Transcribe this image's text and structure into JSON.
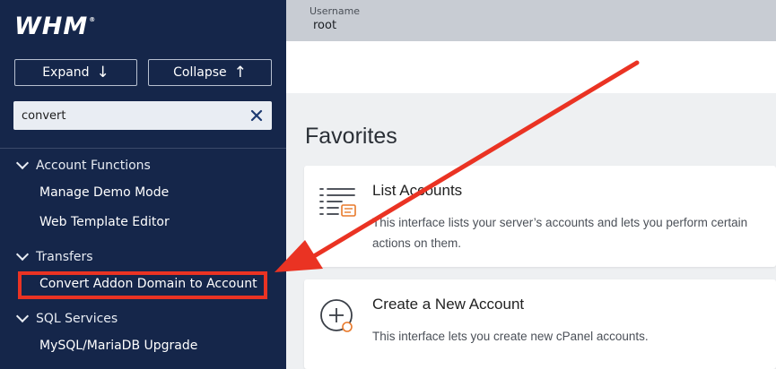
{
  "sidebar": {
    "logo": "WHM",
    "logo_mark": "®",
    "expand_label": "Expand",
    "collapse_label": "Collapse",
    "search_value": "convert",
    "groups": [
      {
        "label": "Account Functions",
        "items": [
          "Manage Demo Mode",
          "Web Template Editor"
        ]
      },
      {
        "label": "Transfers",
        "items": [
          "Convert Addon Domain to Account"
        ]
      },
      {
        "label": "SQL Services",
        "items": [
          "MySQL/MariaDB Upgrade"
        ]
      }
    ]
  },
  "header": {
    "username_label": "Username",
    "username_value": "root"
  },
  "main": {
    "favorites_title": "Favorites",
    "cards": [
      {
        "title": "List Accounts",
        "description": "This interface lists your server’s accounts and lets you perform certain actions on them."
      },
      {
        "title": "Create a New Account",
        "description": "This interface lets you create new cPanel accounts."
      }
    ]
  },
  "colors": {
    "sidebar_bg": "#15264a",
    "highlight_red": "#ea3323",
    "accent_orange": "#e8792a"
  }
}
